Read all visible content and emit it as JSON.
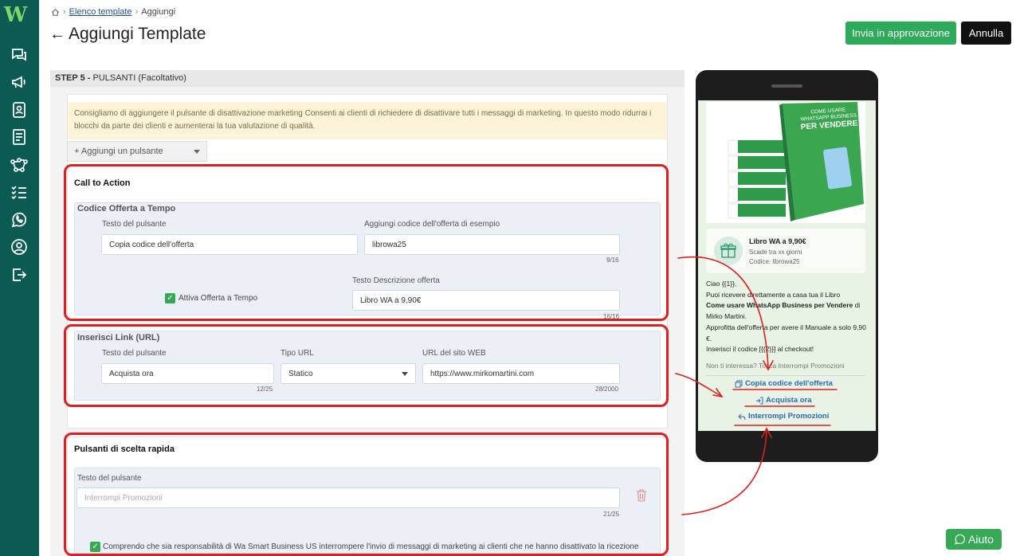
{
  "breadcrumb": {
    "parent": "Elenco template",
    "current": "Aggiungi"
  },
  "header": {
    "title": "Aggiungi Template",
    "approve_label": "Invia in approvazione",
    "cancel_label": "Annulla"
  },
  "step": {
    "number": "STEP 5 -",
    "name": "PULSANTI (Facoltativo)"
  },
  "notice": "Consigliamo di aggiungere il pulsante di disattivazione marketing Consenti ai clienti di richiedere di disattivare tutti i messaggi di marketing. In questo modo ridurrai i blocchi da parte dei clienti e aumenterai la tua valutazione di qualità.",
  "add_button": "+ Aggiungi un pulsante",
  "cta": {
    "title": "Call to Action",
    "offer": {
      "title": "Codice Offerta a Tempo",
      "button_text_label": "Testo del pulsante",
      "button_text_value": "Copia codice dell'offerta",
      "code_label": "Aggiungi codice dell'offerta di esempio",
      "code_value": "librowa25",
      "code_counter": "9/16",
      "timed_offer_label": "Attiva Offerta a Tempo",
      "desc_label": "Testo Descrizione offerta",
      "desc_value": "Libro WA a 9,90€",
      "desc_counter": "16/16"
    },
    "link": {
      "title": "Inserisci Link (URL)",
      "button_text_label": "Testo del pulsante",
      "button_text_value": "Acquista ora",
      "button_counter": "12/25",
      "type_label": "Tipo URL",
      "type_value": "Statico",
      "url_label": "URL del sito WEB",
      "url_value": "https://www.mirkomartini.com",
      "url_counter": "28/2000"
    }
  },
  "quick": {
    "title": "Pulsanti di scelta rapida",
    "button_text_label": "Testo del pulsante",
    "placeholder": "Interrompi Promozioni",
    "counter": "21/25",
    "consent_label": "Comprendo che sia responsabilità di Wa Smart Business US interrompere l'invio di messaggi di marketing ai clienti che ne hanno disattivato la ricezione"
  },
  "preview": {
    "book_title_1": "COME USARE",
    "book_title_2": "WHATSAPP BUSINESS",
    "book_title_3": "PER VENDERE",
    "offer_title": "Libro WA a 9,90€",
    "offer_expiry": "Scade tra xx giorni",
    "offer_code": "Codice: librowa25",
    "msg_line1": "Ciao {{1}},",
    "msg_line2": "Puoi ricevere direttamente a casa tua il Libro",
    "msg_bold": "Come usare WhatsApp Business per Vendere",
    "msg_line3_tail": " di",
    "msg_line4": "Mirko Martini.",
    "msg_line5": "Approfitta dell'offerta per avere il Manuale a solo 9,90 €.",
    "msg_line6": "Inserisci il codice [{{2}}] al checkout!",
    "msg_optout": "Non ti interessa? Tocca Interrompi Promozioni",
    "btn_copy": "Copia codice dell'offerta",
    "btn_buy": "Acquista ora",
    "btn_stop": "Interrompi Promozioni"
  },
  "help_label": "Aiuto",
  "colors": {
    "sidebar": "#0c5b52",
    "primary": "#2eaa5b",
    "annotation": "#e01e1e"
  }
}
